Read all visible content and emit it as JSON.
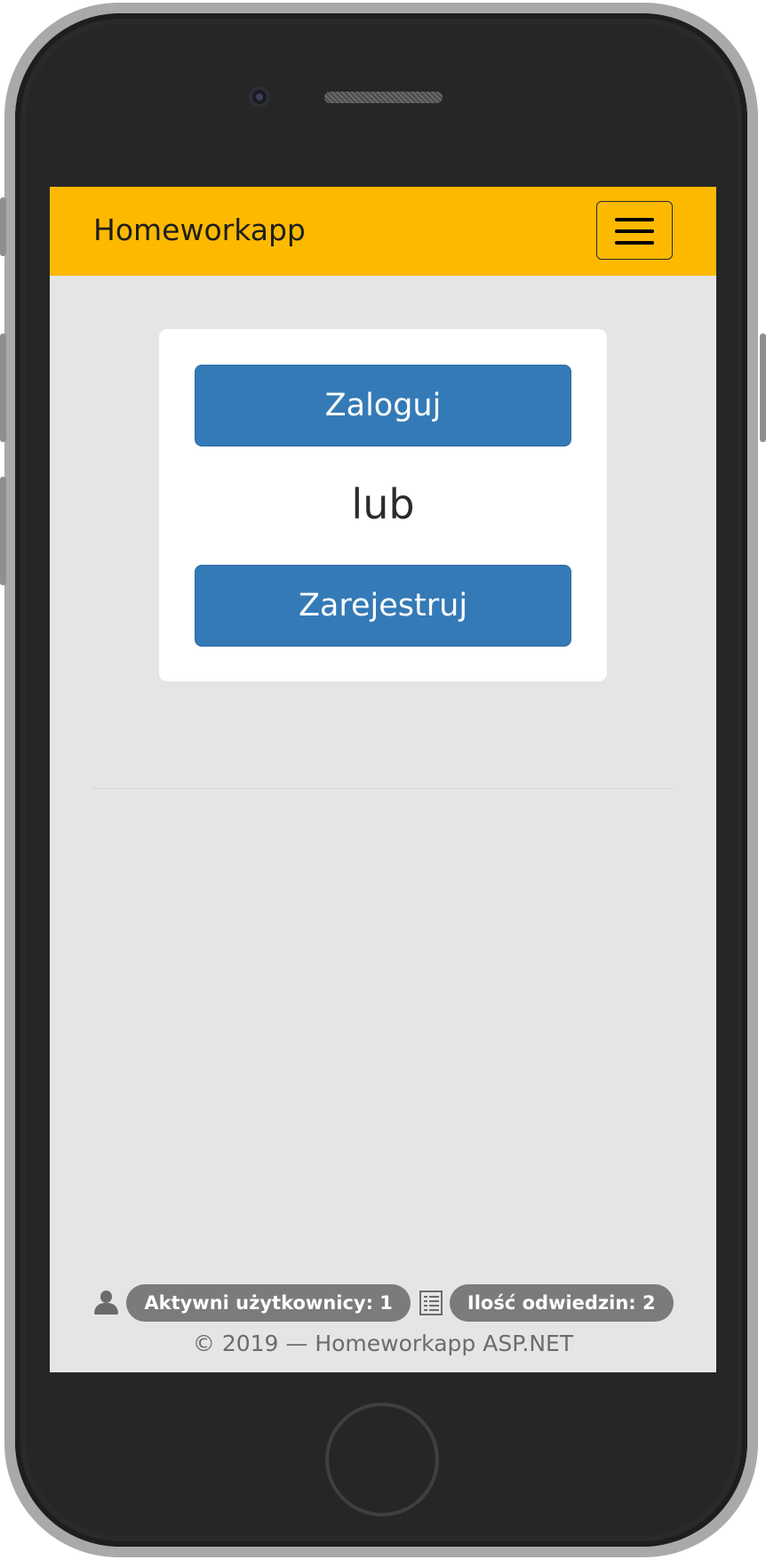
{
  "navbar": {
    "brand": "Homeworkapp",
    "toggle_icon": "hamburger-menu-icon"
  },
  "auth_card": {
    "login_label": "Zaloguj",
    "or_text": "lub",
    "register_label": "Zarejestruj"
  },
  "footer": {
    "active_users_icon": "user-icon",
    "active_users_label": "Aktywni użytkownicy: 1",
    "visits_icon": "list-icon",
    "visits_label": "Ilość odwiedzin: 2",
    "copyright": "© 2019 — Homeworkapp ASP.NET"
  },
  "colors": {
    "navbar": "#fdb900",
    "button": "#347ab7",
    "page_background": "#e6e5e6",
    "badge": "#7b7b7b"
  }
}
